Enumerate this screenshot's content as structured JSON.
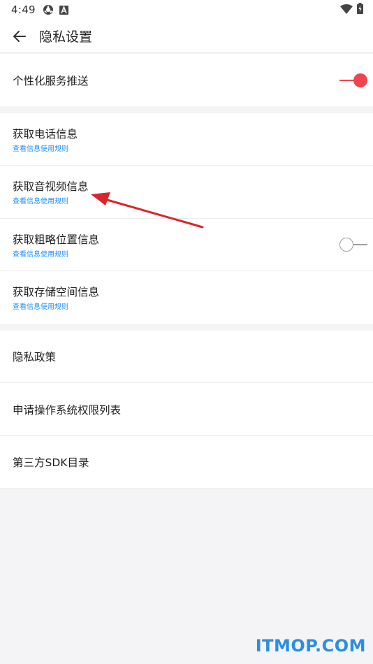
{
  "status_bar": {
    "time": "4:49"
  },
  "app_bar": {
    "title": "隐私设置"
  },
  "group1": {
    "personalized": {
      "title": "个性化服务推送",
      "toggle_on": true
    }
  },
  "group2": {
    "items": [
      {
        "title": "获取电话信息",
        "sub": "查看信息使用规则"
      },
      {
        "title": "获取音视频信息",
        "sub": "查看信息使用规则"
      },
      {
        "title": "获取粗略位置信息",
        "sub": "查看信息使用规则",
        "toggle_on": false
      },
      {
        "title": "获取存储空间信息",
        "sub": "查看信息使用规则"
      }
    ]
  },
  "group3": {
    "items": [
      {
        "title": "隐私政策"
      },
      {
        "title": "申请操作系统权限列表"
      },
      {
        "title": "第三方SDK目录"
      }
    ]
  },
  "colors": {
    "accent": "#f0454e",
    "link": "#1e90ff",
    "annotation": "#d8262b"
  },
  "watermark": "ITMOP.COM"
}
